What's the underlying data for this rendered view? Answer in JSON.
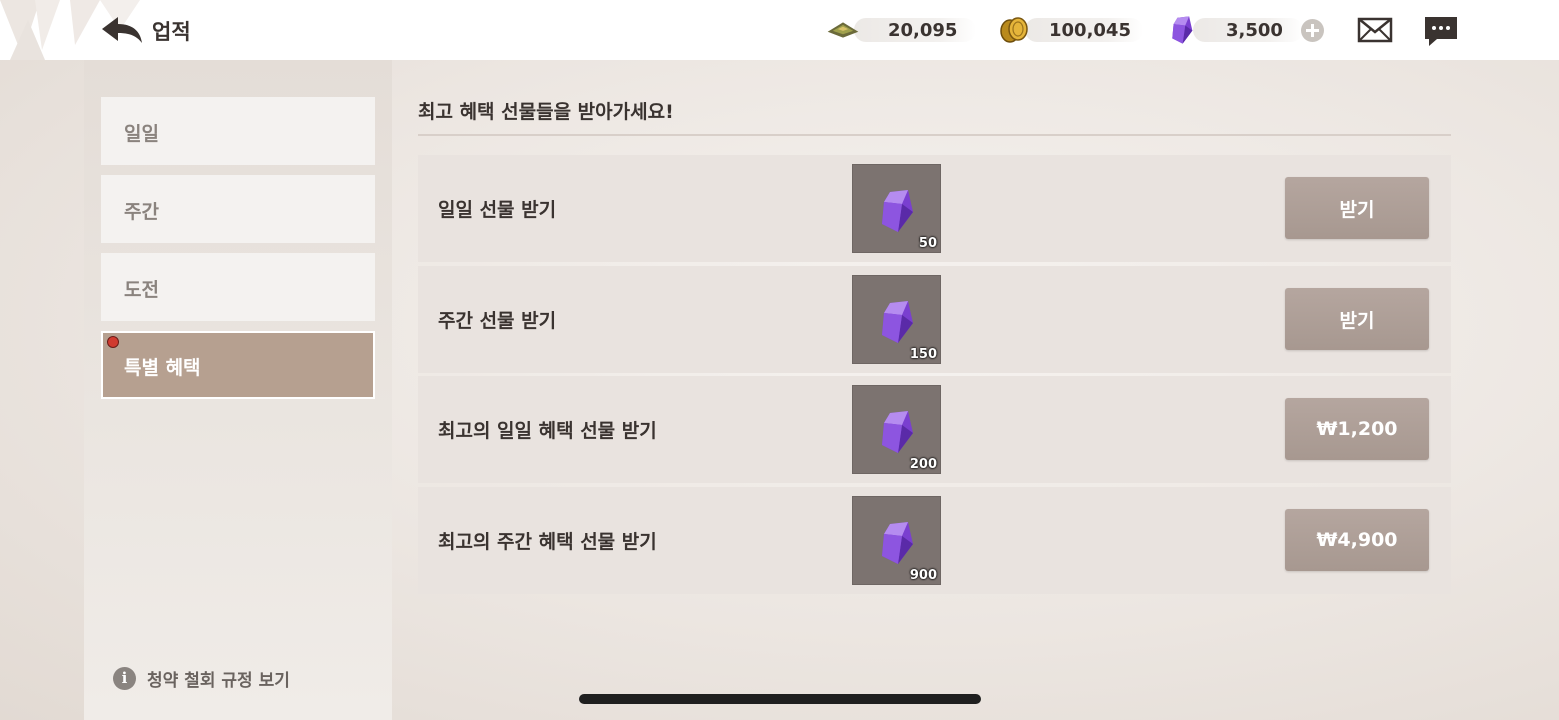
{
  "header": {
    "title": "업적",
    "currencies": [
      {
        "name": "stamina",
        "icon": "stamina-icon",
        "value": "20,095"
      },
      {
        "name": "gold",
        "icon": "gold-coin-icon",
        "value": "100,045"
      },
      {
        "name": "gem",
        "icon": "purple-gem-icon",
        "value": "3,500"
      }
    ]
  },
  "sidebar": {
    "tabs": [
      {
        "label": "일일",
        "active": false
      },
      {
        "label": "주간",
        "active": false
      },
      {
        "label": "도전",
        "active": false
      },
      {
        "label": "특별 혜택",
        "active": true,
        "notification": true
      }
    ]
  },
  "main": {
    "heading": "최고 혜택 선물들을 받아가세요!",
    "rows": [
      {
        "label": "일일 선물 받기",
        "reward_icon": "purple-gem-icon",
        "reward_qty": "50",
        "button": "받기"
      },
      {
        "label": "주간 선물 받기",
        "reward_icon": "purple-gem-icon",
        "reward_qty": "150",
        "button": "받기"
      },
      {
        "label": "최고의 일일 혜택 선물 받기",
        "reward_icon": "purple-gem-icon",
        "reward_qty": "200",
        "button": "₩1,200"
      },
      {
        "label": "최고의 주간 혜택 선물 받기",
        "reward_icon": "purple-gem-icon",
        "reward_qty": "900",
        "button": "₩4,900"
      }
    ]
  },
  "footer": {
    "info_link": "청약 철회 규정 보기"
  },
  "colors": {
    "active_tab": "#b6a090",
    "button": "#ab9c94",
    "notification": "#d03a2f"
  }
}
